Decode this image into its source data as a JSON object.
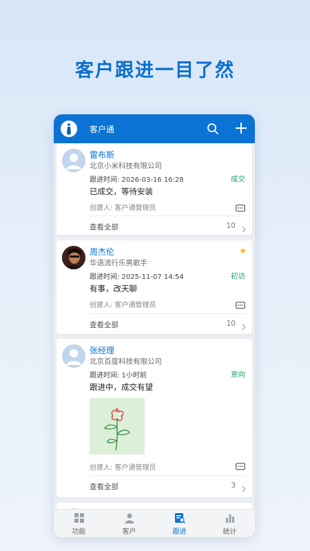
{
  "headline": "客户跟进一目了然",
  "app": {
    "title": "客户通"
  },
  "cards": [
    {
      "name": "雷布斯",
      "company": "北京小米科技有限公司",
      "time_label": "跟进时间: 2026-03-16 16:28",
      "stage": "成交",
      "content": "已成交，等待安装",
      "creator": "创建人: 客户通管理员",
      "view_all": "查看全部",
      "count": "10"
    },
    {
      "name": "周杰伦",
      "company": "华语流行乐男歌手",
      "time_label": "跟进时间: 2025-11-07 14:54",
      "stage": "初访",
      "content": "有事，改天聊",
      "creator": "创建人: 客户通管理员",
      "view_all": "查看全部",
      "count": "10",
      "starred": true
    },
    {
      "name": "张经理",
      "company": "北京百度科技有限公司",
      "time_label": "跟进时间: 1小时前",
      "stage": "意向",
      "content": "跟进中，成交有望",
      "creator": "创建人: 客户通管理员",
      "view_all": "查看全部",
      "count": "3"
    }
  ],
  "tabs": [
    {
      "label": "功能",
      "icon": "grid-icon"
    },
    {
      "label": "客户",
      "icon": "person-icon"
    },
    {
      "label": "跟进",
      "icon": "followup-icon",
      "active": true
    },
    {
      "label": "统计",
      "icon": "bar-chart-icon"
    }
  ],
  "colors": {
    "brand": "#0b73d3",
    "stage": "#22a36b",
    "star": "#f1b81b"
  }
}
